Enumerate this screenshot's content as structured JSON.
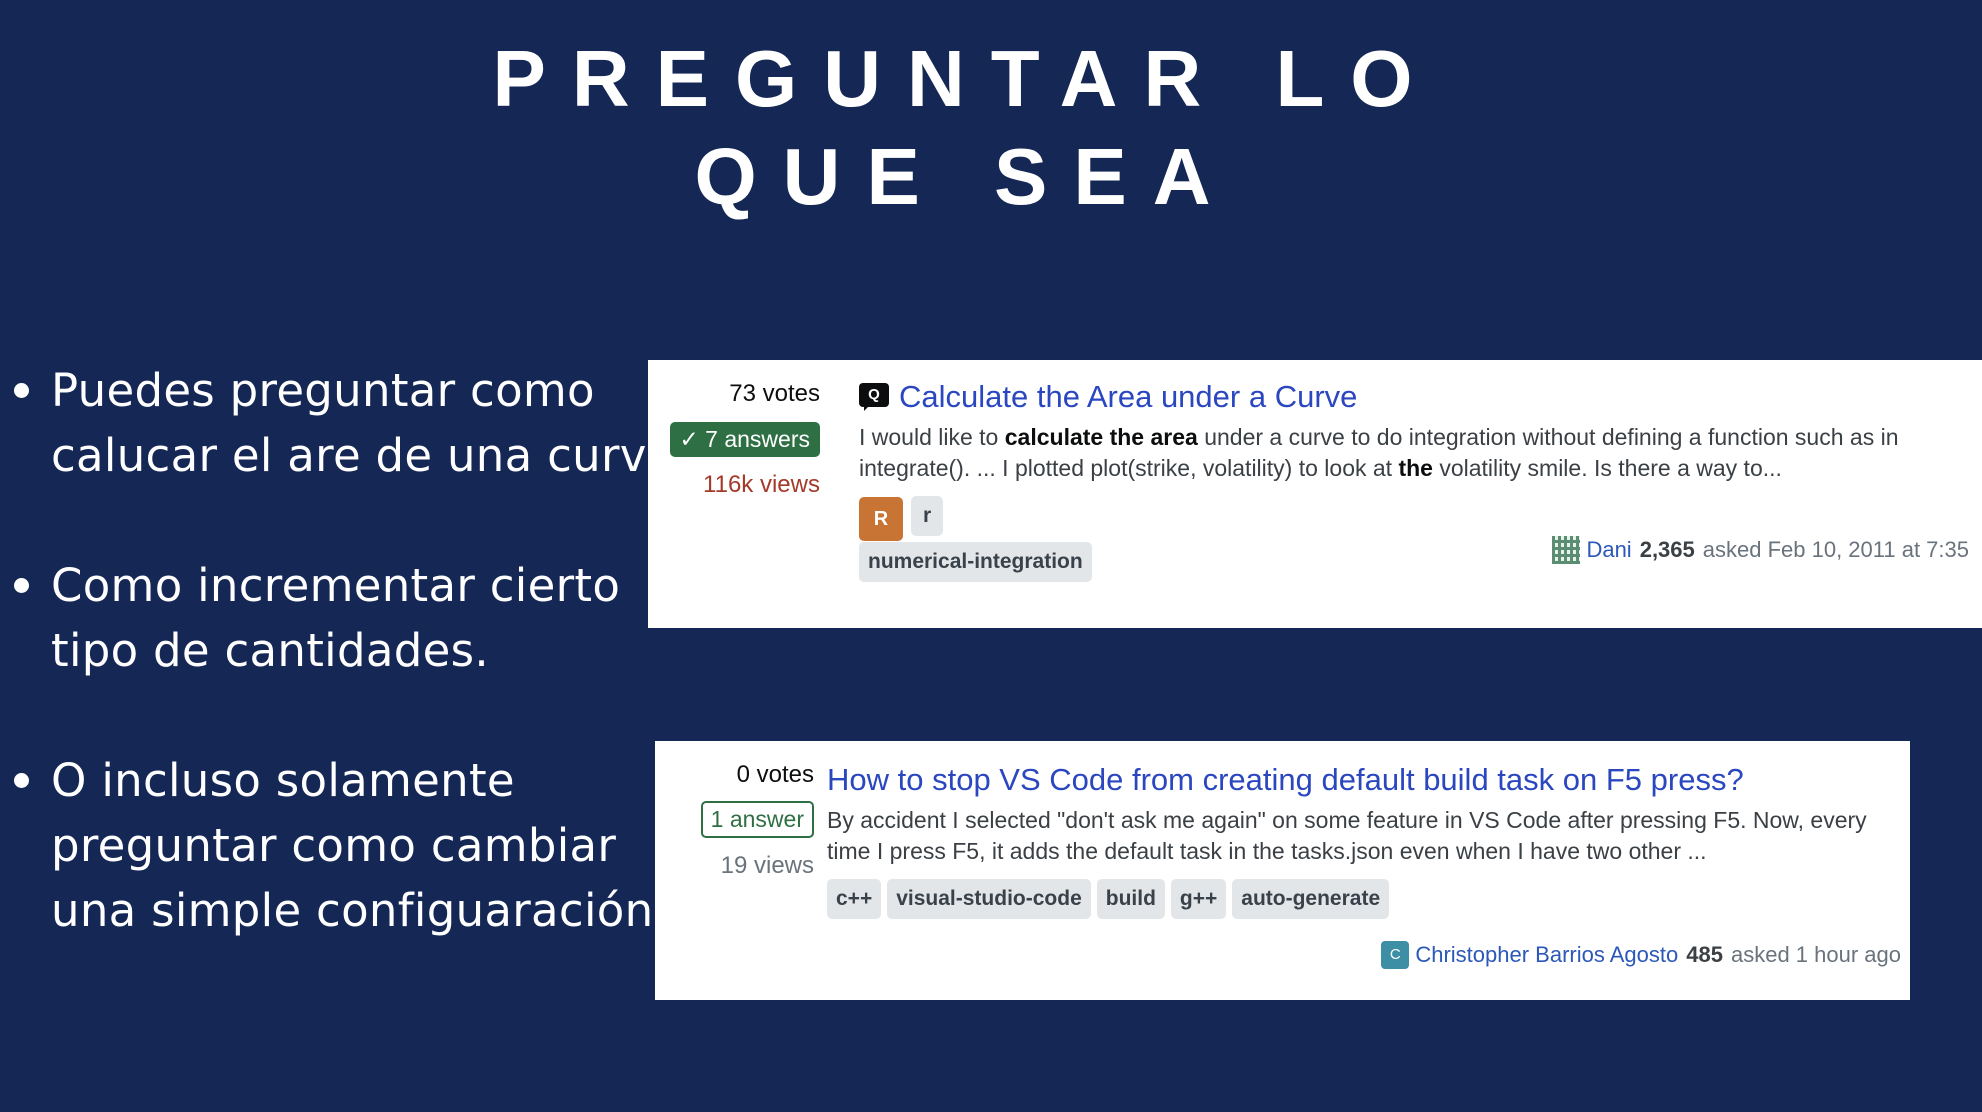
{
  "slide": {
    "title_line1": "PREGUNTAR LO",
    "title_line2": "QUE SEA",
    "bullets": [
      [
        "Puedes preguntar como",
        "calucar el are de una curva."
      ],
      [
        "Como incrementar cierto",
        "tipo de cantidades."
      ],
      [
        "O incluso solamente",
        "preguntar como cambiar",
        "una simple configuaración."
      ]
    ]
  },
  "questions": [
    {
      "votes": "73 votes",
      "answers": "7 answers",
      "views": "116k views",
      "badge": "Q",
      "title": "Calculate the Area under a Curve",
      "excerpt_parts": {
        "a": "I would like to ",
        "b": "calculate the area",
        "c": " under a curve to do integration without defining a function such as in integrate(). ... I plotted plot(strike, volatility) to look at ",
        "d": "the",
        "e": " volatility smile. Is there a way to..."
      },
      "tag_icon": "R",
      "tags": [
        "r",
        "numerical-integration"
      ],
      "owner": {
        "name": "Dani",
        "rep": "2,365",
        "asked": "asked Feb 10, 2011 at 7:35"
      }
    },
    {
      "votes": "0 votes",
      "answers": "1 answer",
      "views": "19 views",
      "title": "How to stop VS Code from creating default build task on F5 press?",
      "excerpt": "By accident I selected \"don't ask me again\" on some feature in VS Code after pressing F5. Now, every time I press F5, it adds the default task in the tasks.json even when I have two other ...",
      "tags": [
        "c++",
        "visual-studio-code",
        "build",
        "g++",
        "auto-generate"
      ],
      "owner": {
        "avatar": "C",
        "name": "Christopher Barrios Agosto",
        "rep": "485",
        "asked": "asked 1 hour ago"
      }
    }
  ]
}
